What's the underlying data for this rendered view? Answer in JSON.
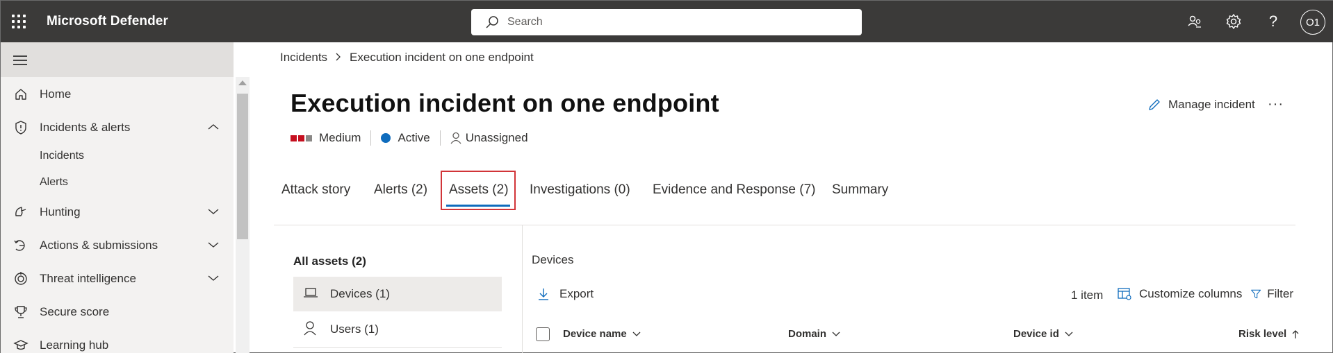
{
  "app": {
    "title": "Microsoft Defender"
  },
  "search": {
    "placeholder": "Search"
  },
  "user": {
    "initials": "O1"
  },
  "sidebar": {
    "items": [
      {
        "label": "Home",
        "icon": "home-icon"
      },
      {
        "label": "Incidents & alerts",
        "icon": "shield-icon",
        "expanded": true,
        "children": [
          {
            "label": "Incidents"
          },
          {
            "label": "Alerts"
          }
        ]
      },
      {
        "label": "Hunting",
        "icon": "hunting-icon",
        "expanded": false
      },
      {
        "label": "Actions & submissions",
        "icon": "actions-icon",
        "expanded": false
      },
      {
        "label": "Threat intelligence",
        "icon": "threat-intel-icon",
        "expanded": false
      },
      {
        "label": "Secure score",
        "icon": "trophy-icon"
      },
      {
        "label": "Learning hub",
        "icon": "learning-icon"
      }
    ]
  },
  "breadcrumb": {
    "root": "Incidents",
    "current": "Execution incident on one endpoint"
  },
  "incident": {
    "title": "Execution incident on one endpoint",
    "severity": "Medium",
    "status": "Active",
    "assignee": "Unassigned",
    "manage_label": "Manage incident",
    "more_label": "···"
  },
  "colors": {
    "severity": "#c50f1f",
    "severity_off": "#8a8886",
    "status_active": "#0f6cbd",
    "highlight": "#d13438",
    "accent": "#0f6cbd"
  },
  "tabs": [
    {
      "label": "Attack story"
    },
    {
      "label": "Alerts (2)"
    },
    {
      "label": "Assets (2)",
      "selected": true
    },
    {
      "label": "Investigations (0)"
    },
    {
      "label": "Evidence and Response (7)"
    },
    {
      "label": "Summary"
    }
  ],
  "assets": {
    "heading": "All assets (2)",
    "items": [
      {
        "label": "Devices (1)",
        "icon": "laptop-icon",
        "selected": true
      },
      {
        "label": "Users (1)",
        "icon": "user-icon"
      }
    ]
  },
  "devices": {
    "title": "Devices",
    "export_label": "Export",
    "item_count": "1 item",
    "customize_label": "Customize columns",
    "filter_label": "Filter",
    "columns": [
      "Device name",
      "Domain",
      "Device id",
      "Risk level"
    ]
  }
}
